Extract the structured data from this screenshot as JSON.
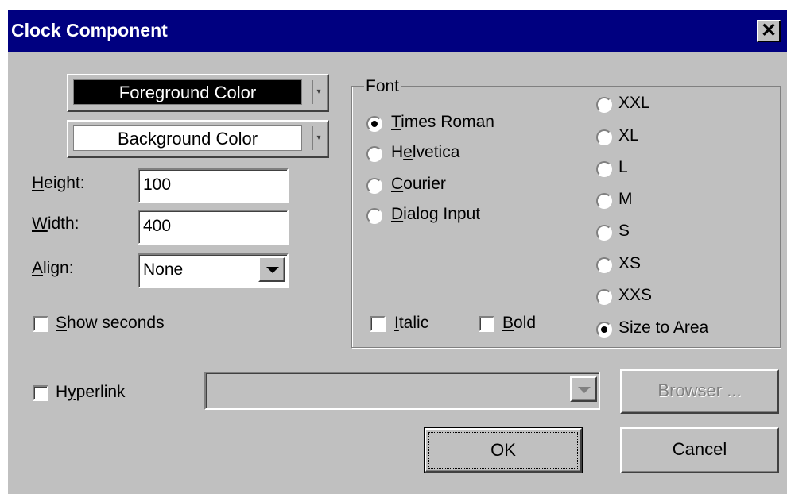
{
  "window": {
    "title": "Clock Component",
    "close_glyph": "✕"
  },
  "colors": {
    "titlebar": "#000080",
    "face": "#c0c0c0"
  },
  "colors_section": {
    "foreground_label": "Foreground Color",
    "background_label": "Background Color"
  },
  "fields": {
    "height": {
      "label_pre": "",
      "label_u": "H",
      "label_post": "eight:",
      "value": "100"
    },
    "width": {
      "label_pre": "",
      "label_u": "W",
      "label_post": "idth:",
      "value": "400"
    },
    "align": {
      "label_pre": "",
      "label_u": "A",
      "label_post": "lign:",
      "value": "None"
    }
  },
  "show_seconds": {
    "label_pre": "",
    "label_u": "S",
    "label_post": "how seconds",
    "checked": false
  },
  "font": {
    "group_label": "Font",
    "families": [
      {
        "pre": "",
        "u": "T",
        "post": "imes Roman",
        "selected": true
      },
      {
        "pre": "H",
        "u": "e",
        "post": "lvetica",
        "selected": false
      },
      {
        "pre": "",
        "u": "C",
        "post": "ourier",
        "selected": false
      },
      {
        "pre": "",
        "u": "D",
        "post": "ialog Input",
        "selected": false
      }
    ],
    "sizes": [
      {
        "label": "XXL",
        "selected": false
      },
      {
        "label": "XL",
        "selected": false
      },
      {
        "label": "L",
        "selected": false
      },
      {
        "label": "M",
        "selected": false
      },
      {
        "label": "S",
        "selected": false
      },
      {
        "label": "XS",
        "selected": false
      },
      {
        "label": "XXS",
        "selected": false
      },
      {
        "label": "Size to Area",
        "selected": true
      }
    ],
    "italic": {
      "pre": "",
      "u": "I",
      "post": "talic",
      "checked": false
    },
    "bold": {
      "pre": "",
      "u": "B",
      "post": "old",
      "checked": false
    }
  },
  "hyperlink": {
    "label_pre": "H",
    "label_u": "y",
    "label_post": "perlink",
    "checked": false,
    "value": ""
  },
  "buttons": {
    "browser": "Browser ...",
    "ok": "OK",
    "cancel": "Cancel"
  }
}
